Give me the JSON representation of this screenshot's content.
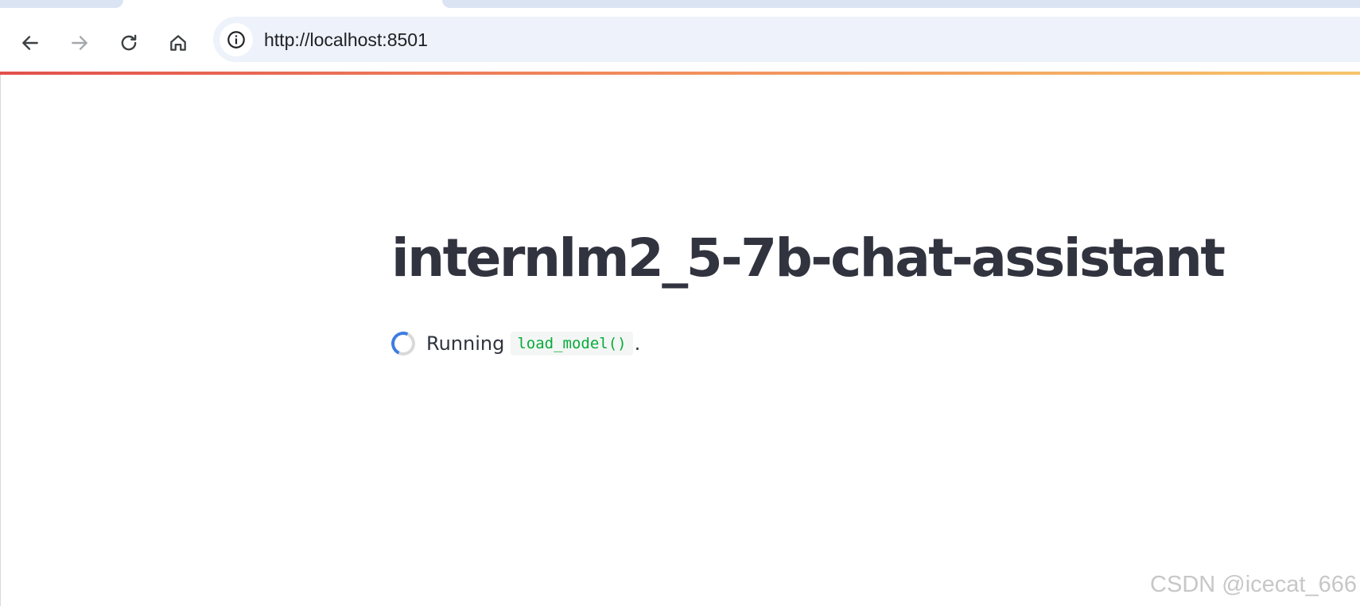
{
  "browser": {
    "url": "http://localhost:8501",
    "icons": {
      "back": "back-arrow-icon",
      "forward": "forward-arrow-icon",
      "reload": "reload-icon",
      "home": "home-icon",
      "site_info": "info-icon"
    }
  },
  "app": {
    "title": "internlm2_5-7b-chat-assistant",
    "status": {
      "prefix": "Running",
      "code": "load_model()",
      "suffix": "."
    }
  },
  "watermark": "CSDN @icecat_666",
  "colors": {
    "title": "#31333f",
    "code": "#09ab3b",
    "spinner_active": "#3d7de0",
    "decoration_start": "#e2504c",
    "decoration_end": "#f7c46c",
    "omnibox_bg": "#edf2fb"
  }
}
